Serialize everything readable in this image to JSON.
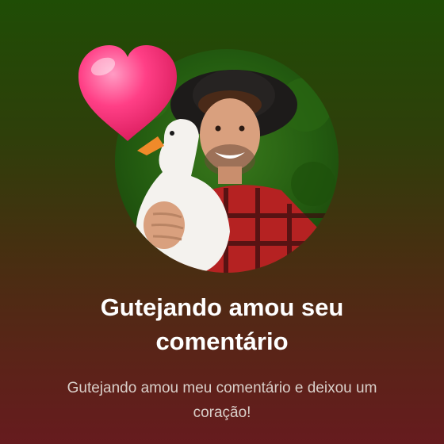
{
  "notification": {
    "title": "Gutejando amou seu comentário",
    "message": "Gutejando amou meu comentário e deixou um coração!"
  },
  "icons": {
    "reaction": "heart-icon"
  },
  "colors": {
    "background_top": "#1f4d05",
    "background_bottom": "#661b1e",
    "heart": "#ff2f7d",
    "title_text": "#ffffff",
    "message_text": "#d9cfc9"
  }
}
